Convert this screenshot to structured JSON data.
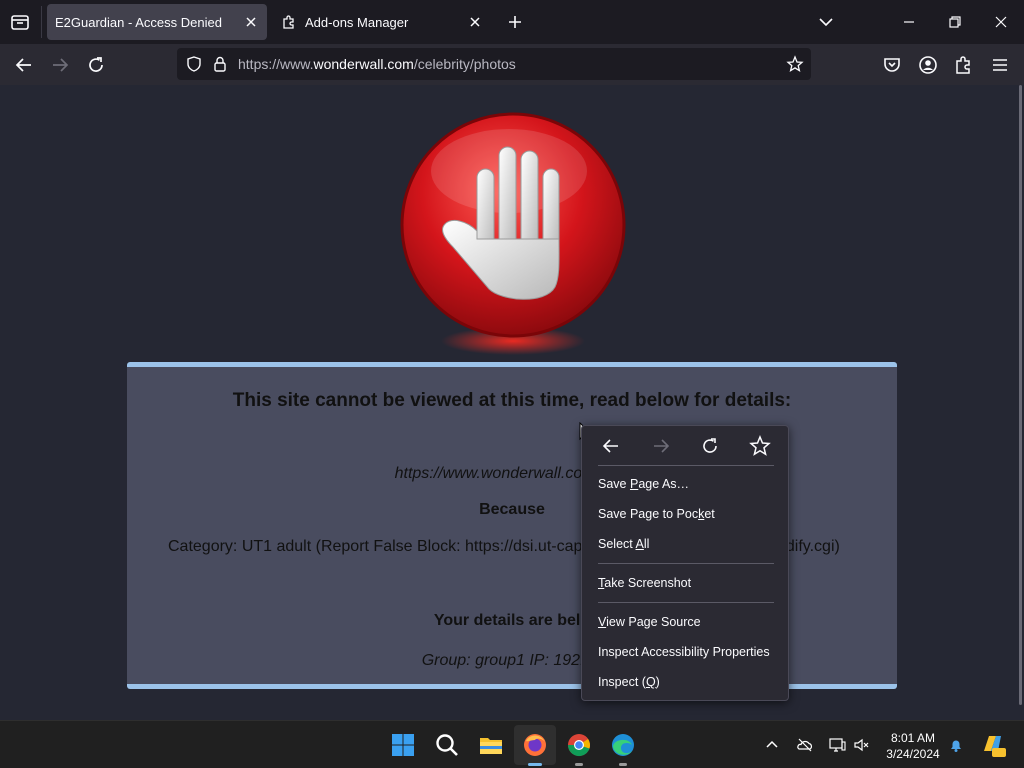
{
  "tabs": [
    {
      "title": "E2Guardian - Access Denied",
      "active": true
    },
    {
      "title": "Add-ons Manager",
      "active": false
    }
  ],
  "urlbar": {
    "prefix": "https://www.",
    "domain": "wonderwall.com",
    "path": "/celebrity/photos"
  },
  "page": {
    "headline": "This site cannot be viewed at this time, read below for details:",
    "blocked_url": "https://www.wonderwall.com/cele",
    "because_label": "Because",
    "category": "Category: UT1 adult (Report False Block: https://dsi.ut-cap",
    "category_tail": "odify.cgi)",
    "details_heading": "Your details are belo",
    "group_line": "Group: group1   IP: 192.16"
  },
  "context_menu": {
    "items": [
      {
        "label": "Save Page As…",
        "shortcut": "P"
      },
      {
        "label": "Save Page to Pocket",
        "shortcut": "k"
      },
      {
        "label": "Select All",
        "shortcut": "A"
      },
      {
        "label": "Take Screenshot",
        "shortcut": "T"
      },
      {
        "label": "View Page Source",
        "shortcut": "V"
      },
      {
        "label": "Inspect Accessibility Properties"
      },
      {
        "label": "Inspect (Q)",
        "shortcut": "Q"
      }
    ]
  },
  "taskbar": {
    "time": "8:01 AM",
    "date": "3/24/2024"
  },
  "colors": {
    "panel_border": "#9cc3ea",
    "panel_bg": "#494c5f",
    "stop_red": "#d4151b",
    "content_bg": "#252733"
  }
}
